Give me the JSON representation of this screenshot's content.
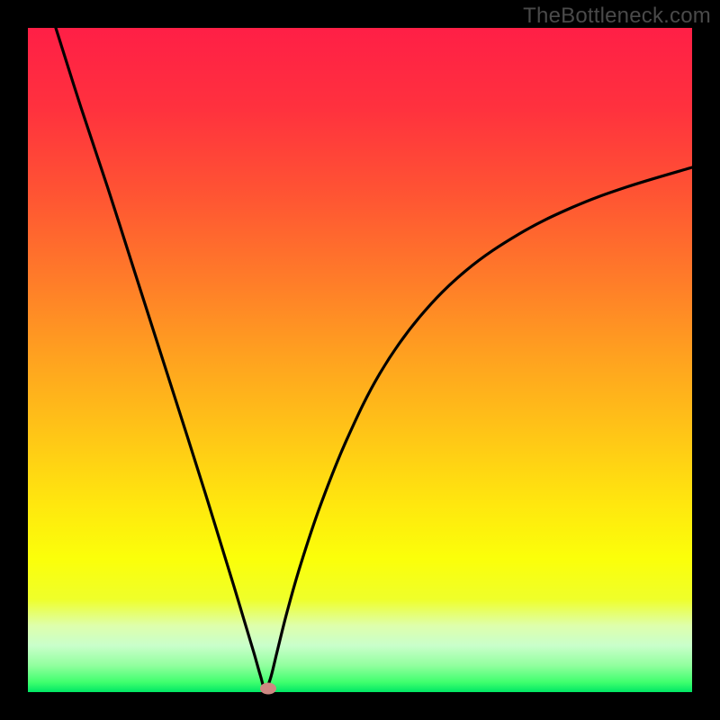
{
  "attribution": "TheBottleneck.com",
  "colors": {
    "frame": "#000000",
    "gradient_stops": [
      {
        "offset": 0.0,
        "color": "#ff1f46"
      },
      {
        "offset": 0.12,
        "color": "#ff313e"
      },
      {
        "offset": 0.25,
        "color": "#ff5433"
      },
      {
        "offset": 0.38,
        "color": "#ff7c29"
      },
      {
        "offset": 0.5,
        "color": "#ffa31f"
      },
      {
        "offset": 0.62,
        "color": "#ffc816"
      },
      {
        "offset": 0.72,
        "color": "#ffe80e"
      },
      {
        "offset": 0.8,
        "color": "#fbff0a"
      },
      {
        "offset": 0.86,
        "color": "#efff2a"
      },
      {
        "offset": 0.9,
        "color": "#deffac"
      },
      {
        "offset": 0.93,
        "color": "#c9ffcb"
      },
      {
        "offset": 0.96,
        "color": "#91ff9e"
      },
      {
        "offset": 0.985,
        "color": "#40ff6e"
      },
      {
        "offset": 1.0,
        "color": "#00e765"
      }
    ],
    "curve": "#000000",
    "marker": "#ce8782"
  },
  "chart_data": {
    "type": "line",
    "title": "",
    "xlabel": "",
    "ylabel": "",
    "xlim": [
      0,
      100
    ],
    "ylim": [
      0,
      100
    ],
    "grid": false,
    "legend": false,
    "optimum_x": 35.7,
    "series": [
      {
        "name": "bottleneck-curve",
        "x": [
          4.2,
          8,
          12,
          16,
          20,
          24,
          27,
          29,
          31,
          32.5,
          34,
          35,
          35.7,
          36.5,
          37.5,
          39,
          41,
          44,
          48,
          53,
          59,
          66,
          74,
          82,
          90,
          100
        ],
        "y": [
          100,
          88,
          76,
          63.5,
          51,
          38.5,
          29,
          22.5,
          16,
          11,
          6,
          2.5,
          0.5,
          2,
          6,
          12,
          19,
          28,
          38,
          48,
          56.5,
          63.5,
          69,
          73,
          76,
          79
        ]
      }
    ],
    "markers": [
      {
        "name": "optimum-marker",
        "x": 36.2,
        "y": 0.6
      }
    ]
  }
}
